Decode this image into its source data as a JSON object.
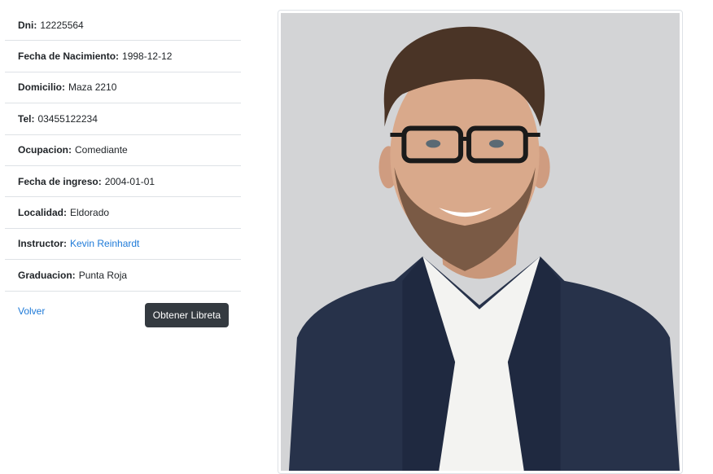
{
  "details": [
    {
      "label": "Dni:",
      "value": "12225564",
      "link": false
    },
    {
      "label": "Fecha de Nacimiento:",
      "value": "1998-12-12",
      "link": false
    },
    {
      "label": "Domicilio:",
      "value": "Maza 2210",
      "link": false
    },
    {
      "label": "Tel:",
      "value": "03455122234",
      "link": false
    },
    {
      "label": "Ocupacion:",
      "value": "Comediante",
      "link": false
    },
    {
      "label": "Fecha de ingreso:",
      "value": "2004-01-01",
      "link": false
    },
    {
      "label": "Localidad:",
      "value": "Eldorado",
      "link": false
    },
    {
      "label": "Instructor:",
      "value": "Kevin Reinhardt",
      "link": true
    },
    {
      "label": "Graduacion:",
      "value": "Punta Roja",
      "link": false
    }
  ],
  "actions": {
    "back_label": "Volver",
    "get_booklet_label": "Obtener Libreta"
  },
  "colors": {
    "link": "#1e7ad8",
    "button_bg": "#343a40",
    "divider": "#dee2e6",
    "photo_bg": "#d3d4d6"
  }
}
